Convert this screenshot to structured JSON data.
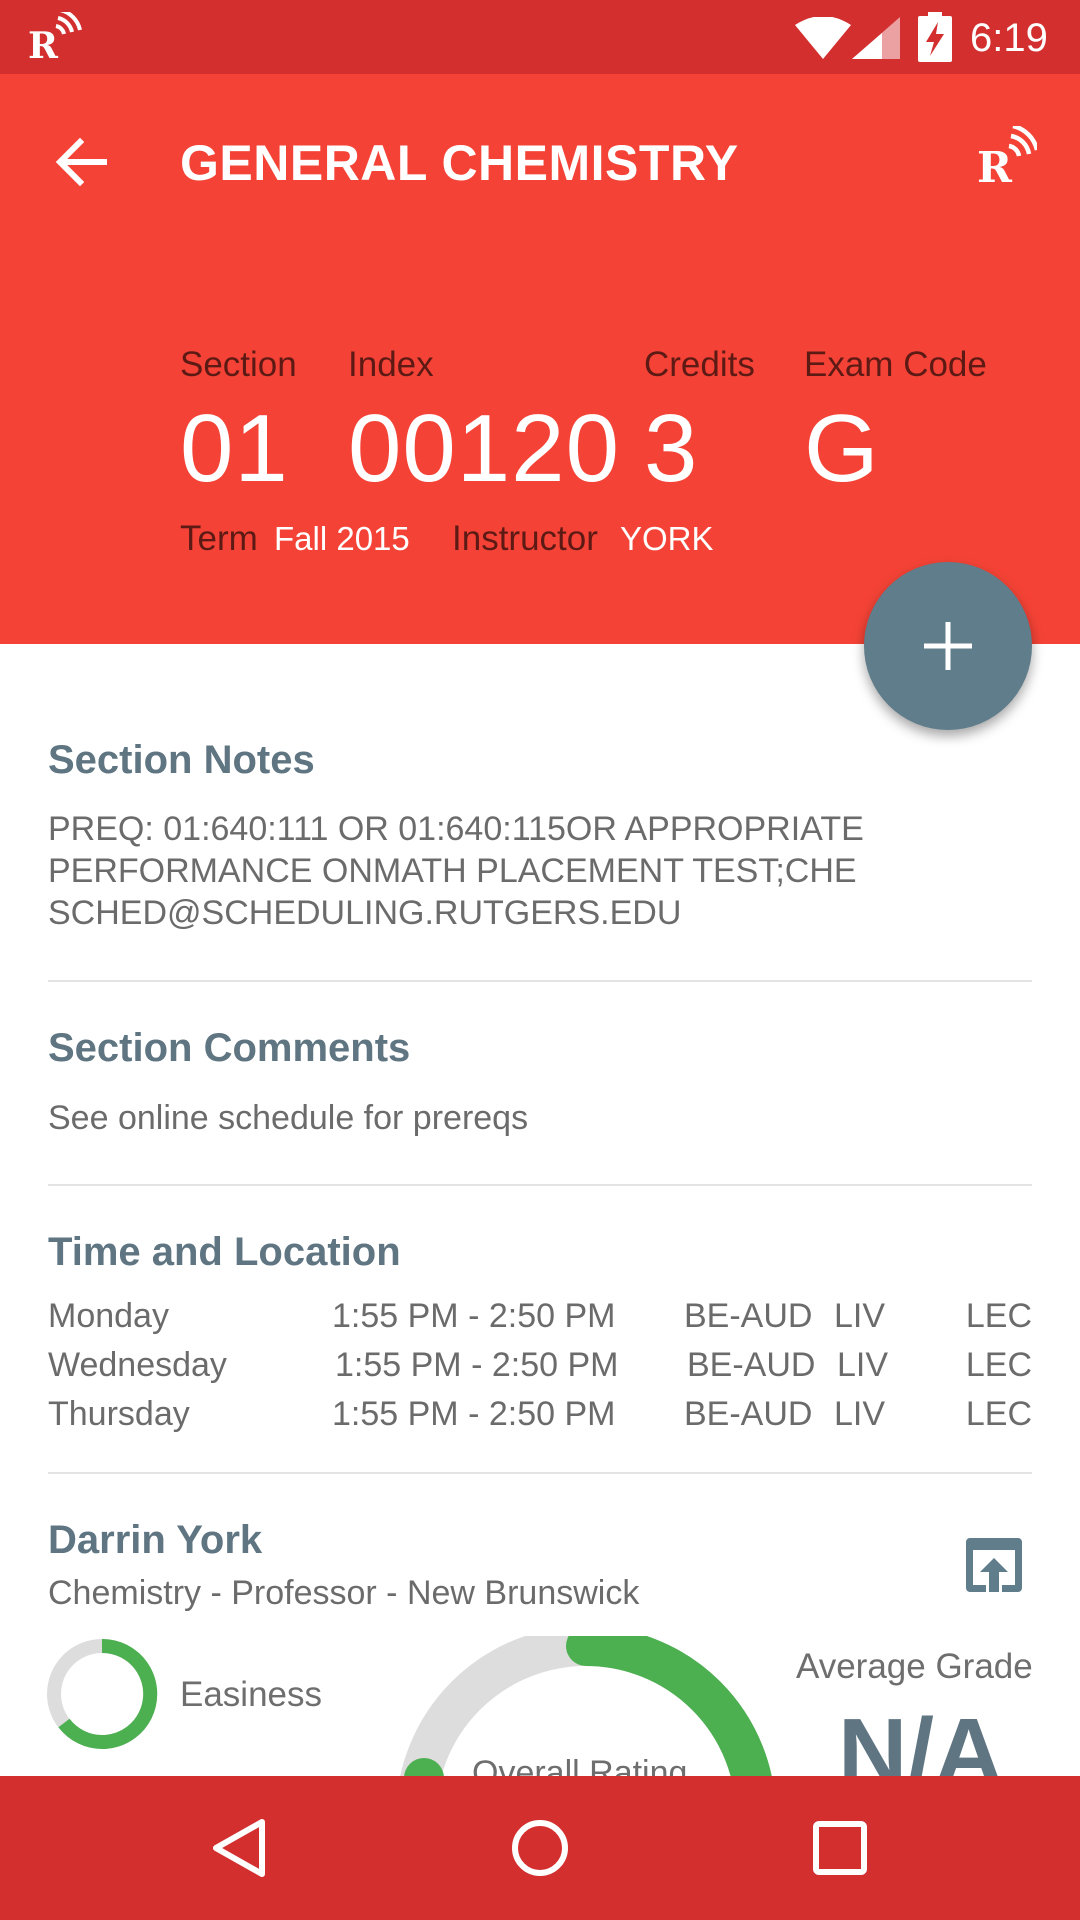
{
  "status_bar": {
    "time": "6:19",
    "icons": [
      "rutgers-radio-icon",
      "wifi-icon",
      "signal-icon",
      "battery-charging-icon"
    ]
  },
  "toolbar": {
    "title": "GENERAL CHEMISTRY",
    "back_icon": "back-arrow-icon",
    "action_icon": "rutgers-radio-icon"
  },
  "course": {
    "section_label": "Section",
    "section_value": "01",
    "index_label": "Index",
    "index_value": "00120",
    "credits_label": "Credits",
    "credits_value": "3",
    "exam_code_label": "Exam Code",
    "exam_code_value": "G",
    "term_label": "Term",
    "term_value": "Fall 2015",
    "instructor_label": "Instructor",
    "instructor_value": "YORK"
  },
  "fab": {
    "icon": "plus-icon"
  },
  "section_notes": {
    "title": "Section Notes",
    "lines": [
      "PREQ: 01:640:111 OR 01:640:115OR APPROPRIATE",
      "PERFORMANCE ONMATH PLACEMENT TEST;CHE",
      "SCHED@SCHEDULING.RUTGERS.EDU"
    ]
  },
  "section_comments": {
    "title": "Section Comments",
    "text": "See online schedule for prereqs"
  },
  "time_location": {
    "title": "Time and Location",
    "rows": [
      {
        "day": "Monday",
        "time": "1:55 PM - 2:50 PM",
        "room": "BE-AUD",
        "campus": "LIV",
        "type": "LEC"
      },
      {
        "day": "Wednesday",
        "time": "1:55 PM - 2:50 PM",
        "room": "BE-AUD",
        "campus": "LIV",
        "type": "LEC"
      },
      {
        "day": "Thursday",
        "time": "1:55 PM - 2:50 PM",
        "room": "BE-AUD",
        "campus": "LIV",
        "type": "LEC"
      }
    ]
  },
  "instructor": {
    "name": "Darrin York",
    "details": "Chemistry - Professor - New Brunswick",
    "open_icon": "open-in-browser-icon",
    "easiness_label": "Easiness",
    "overall_rating_label": "Overall Rating",
    "average_grade_label": "Average Grade",
    "average_grade_value": "N/A"
  },
  "colors": {
    "status_bar": "#d32f2f",
    "header": "#f44336",
    "fab": "#607d8b",
    "section_title": "#5f7582",
    "rating_green": "#4caf50",
    "rating_track": "#dddddd"
  },
  "nav_bar": {
    "icons": [
      "back-triangle-icon",
      "home-circle-icon",
      "recents-square-icon"
    ]
  }
}
